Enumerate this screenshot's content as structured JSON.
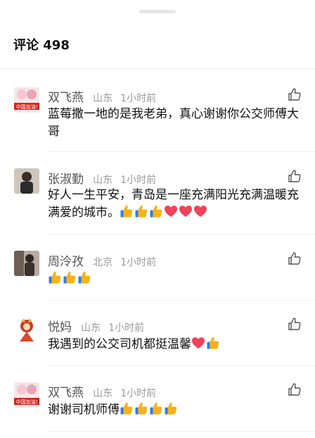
{
  "header": {
    "title": "评论 498"
  },
  "comments": [
    {
      "name": "双飞燕",
      "location": "山东",
      "time": "1小时前",
      "text": "蓝莓撒一地的是我老弟，真心谢谢你公交师傅大哥",
      "avatar_badge": "中国加油!",
      "emojis": []
    },
    {
      "name": "张淑勤",
      "location": "山东",
      "time": "1小时前",
      "text": "好人一生平安，青岛是一座充满阳光充满温暖充满爱的城市。",
      "emojis": [
        "thumbs-up",
        "thumbs-up",
        "thumbs-up",
        "heart",
        "heart",
        "heart"
      ]
    },
    {
      "name": "周泠孜",
      "location": "北京",
      "time": "1小时前",
      "text": "",
      "emojis": [
        "thumbs-up",
        "thumbs-up",
        "thumbs-up"
      ]
    },
    {
      "name": "悦妈",
      "location": "山东",
      "time": "1小时前",
      "text": "我遇到的公交司机都挺温馨",
      "emojis": [
        "heart",
        "thumbs-up"
      ]
    },
    {
      "name": "双飞燕",
      "location": "山东",
      "time": "1小时前",
      "text": "谢谢司机师傅",
      "avatar_badge": "中国加油!",
      "emojis": [
        "thumbs-up",
        "thumbs-up",
        "thumbs-up",
        "thumbs-up"
      ]
    }
  ],
  "colors": {
    "thumb": "#f6b21a",
    "heart": "#f0435b",
    "badge": "#d9251c"
  }
}
